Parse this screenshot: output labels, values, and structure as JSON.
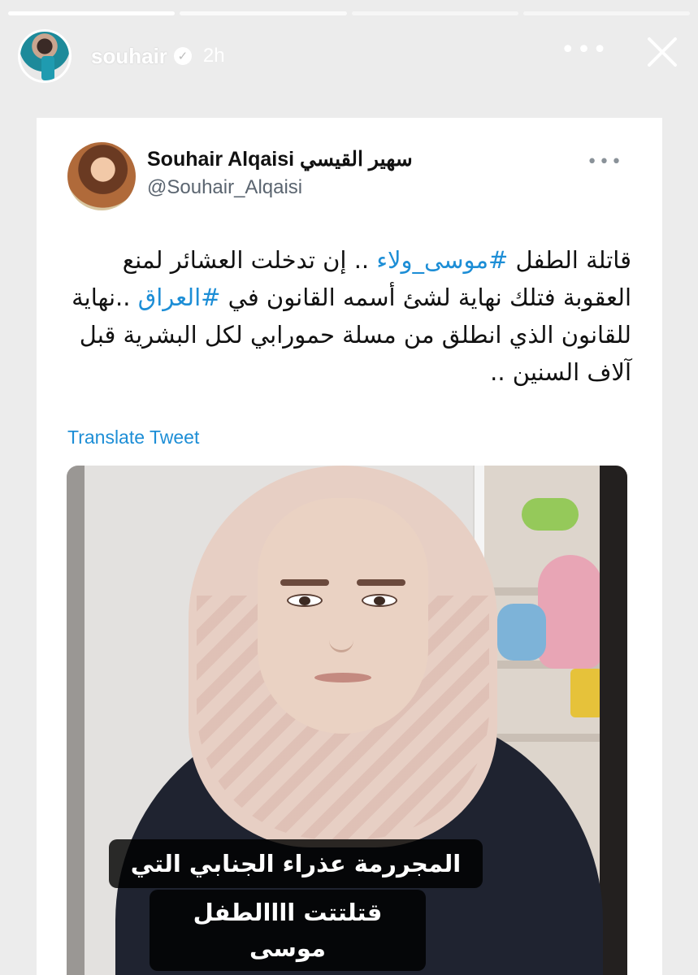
{
  "story": {
    "username": "souhair",
    "time": "2h",
    "verified_icon": "verified-badge-icon",
    "progress_segments": 4
  },
  "tweet": {
    "display_name": "Souhair Alqaisi سهير القيسي",
    "handle": "@Souhair_Alqaisi",
    "text_part1": "قاتلة الطفل ",
    "hashtag1": "#موسى_ولاء",
    "text_part2": " .. إن تدخلت العشائر لمنع العقوبة فتلك نهاية لشئ أسمه القانون في ",
    "hashtag2": "#العراق",
    "text_part3": " ..نهاية للقانون الذي انطلق من مسلة حمورابي لكل البشرية قبل آلاف السنين ..",
    "translate_label": "Translate Tweet",
    "media_caption_line1": "المجررمة عذراء الجنابي التي",
    "media_caption_line2": "قتلتتت اااالطفل موسى"
  },
  "colors": {
    "link": "#1d8ed6",
    "background": "#ececec"
  }
}
